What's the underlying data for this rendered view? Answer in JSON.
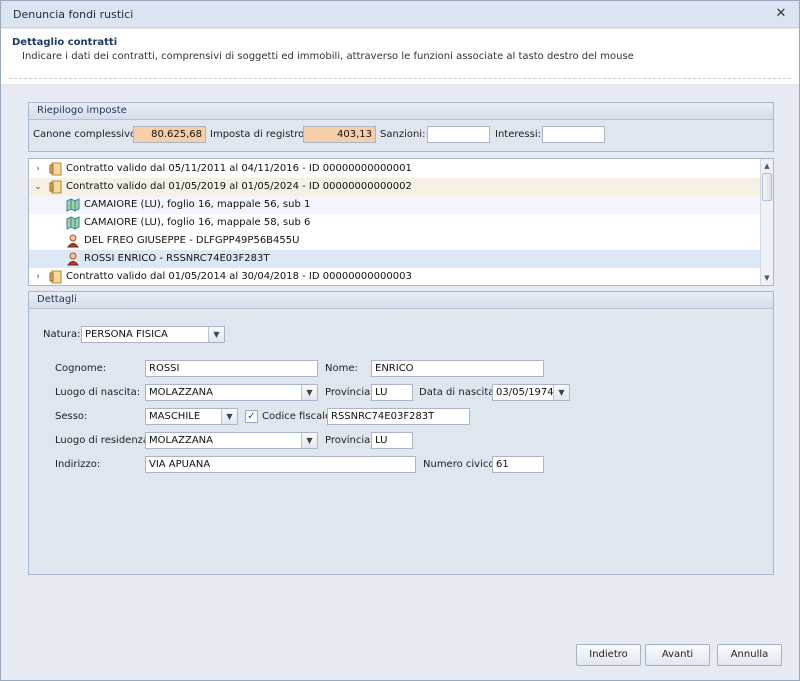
{
  "window": {
    "title": "Denuncia fondi rustici",
    "close_glyph": "✕"
  },
  "header": {
    "title": "Dettaglio contratti",
    "description": "Indicare i dati dei contratti, comprensivi di soggetti ed immobili, attraverso le funzioni associate al tasto destro del mouse"
  },
  "riepilogo": {
    "title": "Riepilogo imposte",
    "canone_label": "Canone complessivo:",
    "canone_value": "80.625,68",
    "imposta_label": "Imposta di registro:",
    "imposta_value": "403,13",
    "sanzioni_label": "Sanzioni:",
    "sanzioni_value": "",
    "interessi_label": "Interessi:",
    "interessi_value": ""
  },
  "tree": {
    "rows": [
      {
        "text": "Contratto valido dal 05/11/2011 al 04/11/2016 - ID 00000000000001",
        "icon": "contract-icon",
        "expander": "›"
      },
      {
        "text": "Contratto valido dal 01/05/2019 al 01/05/2024 - ID 00000000000002",
        "icon": "contract-icon",
        "expander": "⌄"
      },
      {
        "text": "CAMAIORE (LU), foglio 16, mappale 56, sub 1",
        "icon": "map-icon"
      },
      {
        "text": "CAMAIORE (LU), foglio 16, mappale 58, sub 6",
        "icon": "map-icon"
      },
      {
        "text": "DEL FREO GIUSEPPE - DLFGPP49P56B455U",
        "icon": "person-icon"
      },
      {
        "text": "ROSSI ENRICO - RSSNRC74E03F283T",
        "icon": "person-icon"
      },
      {
        "text": "Contratto valido dal 01/05/2014 al 30/04/2018 - ID 00000000000003",
        "icon": "contract-icon",
        "expander": "›"
      }
    ]
  },
  "dettagli": {
    "title": "Dettagli",
    "natura_label": "Natura:",
    "natura_value": "PERSONA FISICA",
    "cognome_label": "Cognome:",
    "cognome_value": "ROSSI",
    "nome_label": "Nome:",
    "nome_value": "ENRICO",
    "luogo_nascita_label": "Luogo di nascita:",
    "luogo_nascita_value": "MOLAZZANA",
    "provincia_label": "Provincia:",
    "provincia_value": "LU",
    "data_nascita_label": "Data di nascita:",
    "data_nascita_value": "03/05/1974",
    "sesso_label": "Sesso:",
    "sesso_value": "MASCHILE",
    "codice_fiscale_label": "Codice fiscale:",
    "codice_fiscale_value": "RSSNRC74E03F283T",
    "luogo_residenza_label": "Luogo di residenza:",
    "luogo_residenza_value": "MOLAZZANA",
    "provincia_res_label": "Provincia:",
    "provincia_res_value": "LU",
    "indirizzo_label": "Indirizzo:",
    "indirizzo_value": "VIA APUANA",
    "numero_civico_label": "Numero civico:",
    "numero_civico_value": "61",
    "check_glyph": "✓"
  },
  "buttons": {
    "back": "Indietro",
    "next": "Avanti",
    "cancel": "Annulla"
  }
}
